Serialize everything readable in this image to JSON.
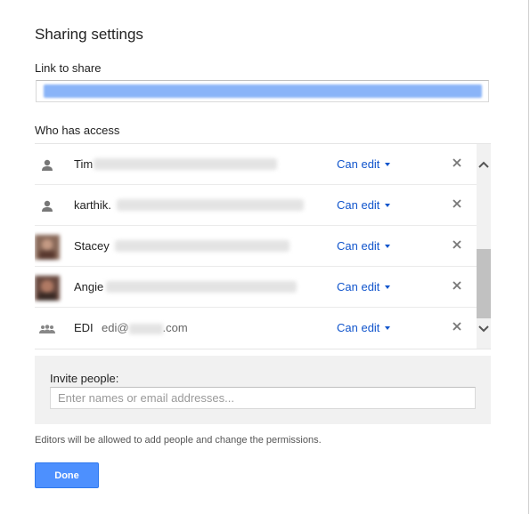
{
  "dialog": {
    "title": "Sharing settings",
    "link_label": "Link to share",
    "who_label": "Who has access",
    "done_label": "Done",
    "note": "Editors will be allowed to add people and change the permissions."
  },
  "access": [
    {
      "name": "Tim",
      "email": "",
      "permission": "Can edit",
      "avatar": "person-icon"
    },
    {
      "name": "karthik.",
      "email": "",
      "permission": "Can edit",
      "avatar": "person-icon"
    },
    {
      "name": "Stacey",
      "email": "",
      "permission": "Can edit",
      "avatar": "profile-photo"
    },
    {
      "name": "Angie",
      "email": "",
      "permission": "Can edit",
      "avatar": "profile-photo"
    },
    {
      "name": "EDI",
      "email": "edi@",
      "email_suffix": ".com",
      "permission": "Can edit",
      "avatar": "group-icon"
    }
  ],
  "invite": {
    "label": "Invite people:",
    "placeholder": "Enter names or email addresses..."
  },
  "colors": {
    "accent": "#4d90fe",
    "link": "#1155cc",
    "panel": "#f1f1f1"
  }
}
